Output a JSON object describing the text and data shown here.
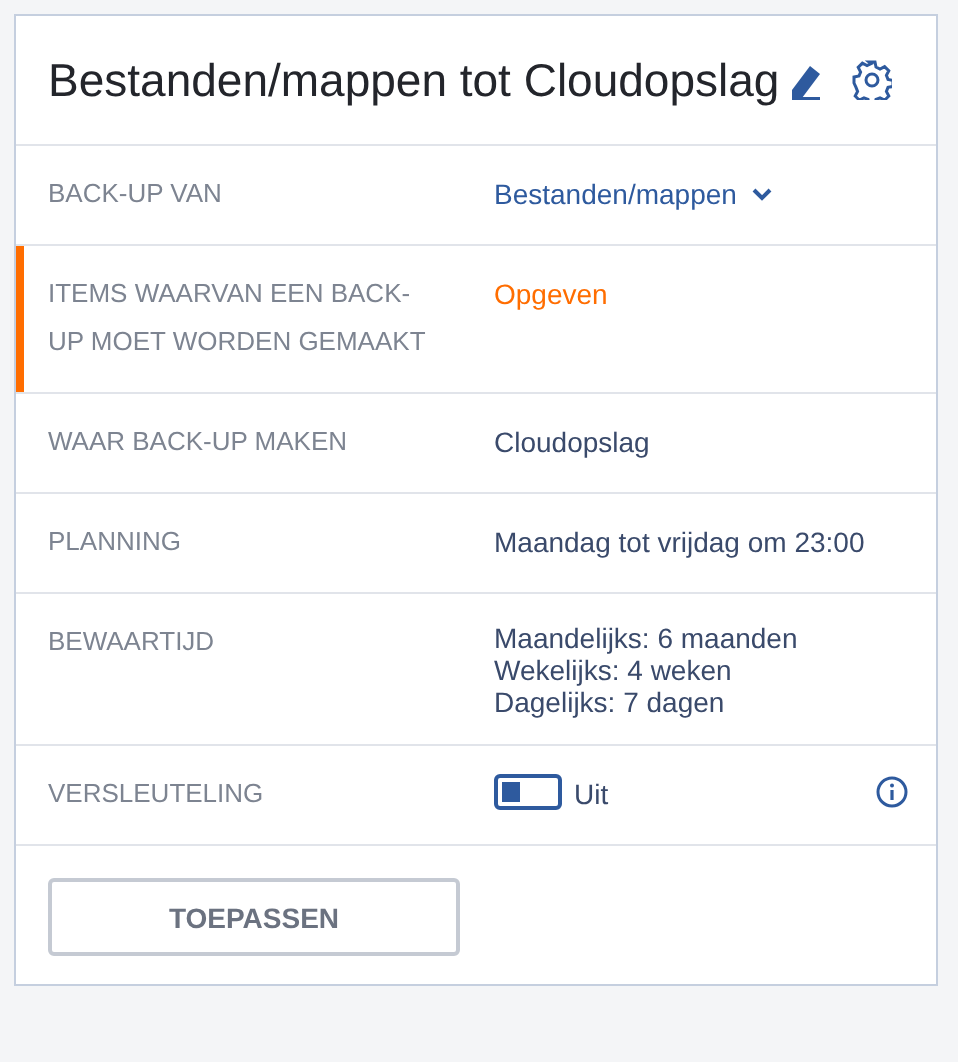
{
  "title": "Bestanden/mappen tot Cloudopslag",
  "rows": [
    {
      "label": "BACK-UP VAN",
      "kind": "dropdown",
      "value": "Bestanden/mappen",
      "attention": false
    },
    {
      "label": "ITEMS WAARVAN EEN BACK-UP MOET WORDEN GEMAAKT",
      "kind": "link",
      "value": "Opgeven",
      "attention": true
    },
    {
      "label": "WAAR BACK-UP MAKEN",
      "kind": "text",
      "value": "Cloudopslag",
      "attention": false
    },
    {
      "label": "PLANNING",
      "kind": "text",
      "value": "Maandag tot vrijdag om 23:00",
      "attention": false
    },
    {
      "label": "BEWAARTIJD",
      "kind": "lines",
      "lines": [
        "Maandelijks: 6 maanden",
        "Wekelijks: 4 weken",
        "Dagelijks: 7 dagen"
      ],
      "attention": false
    },
    {
      "label": "VERSLEUTELING",
      "kind": "toggle",
      "value": "Uit",
      "on": false,
      "attention": false
    }
  ],
  "button": "TOEPASSEN"
}
